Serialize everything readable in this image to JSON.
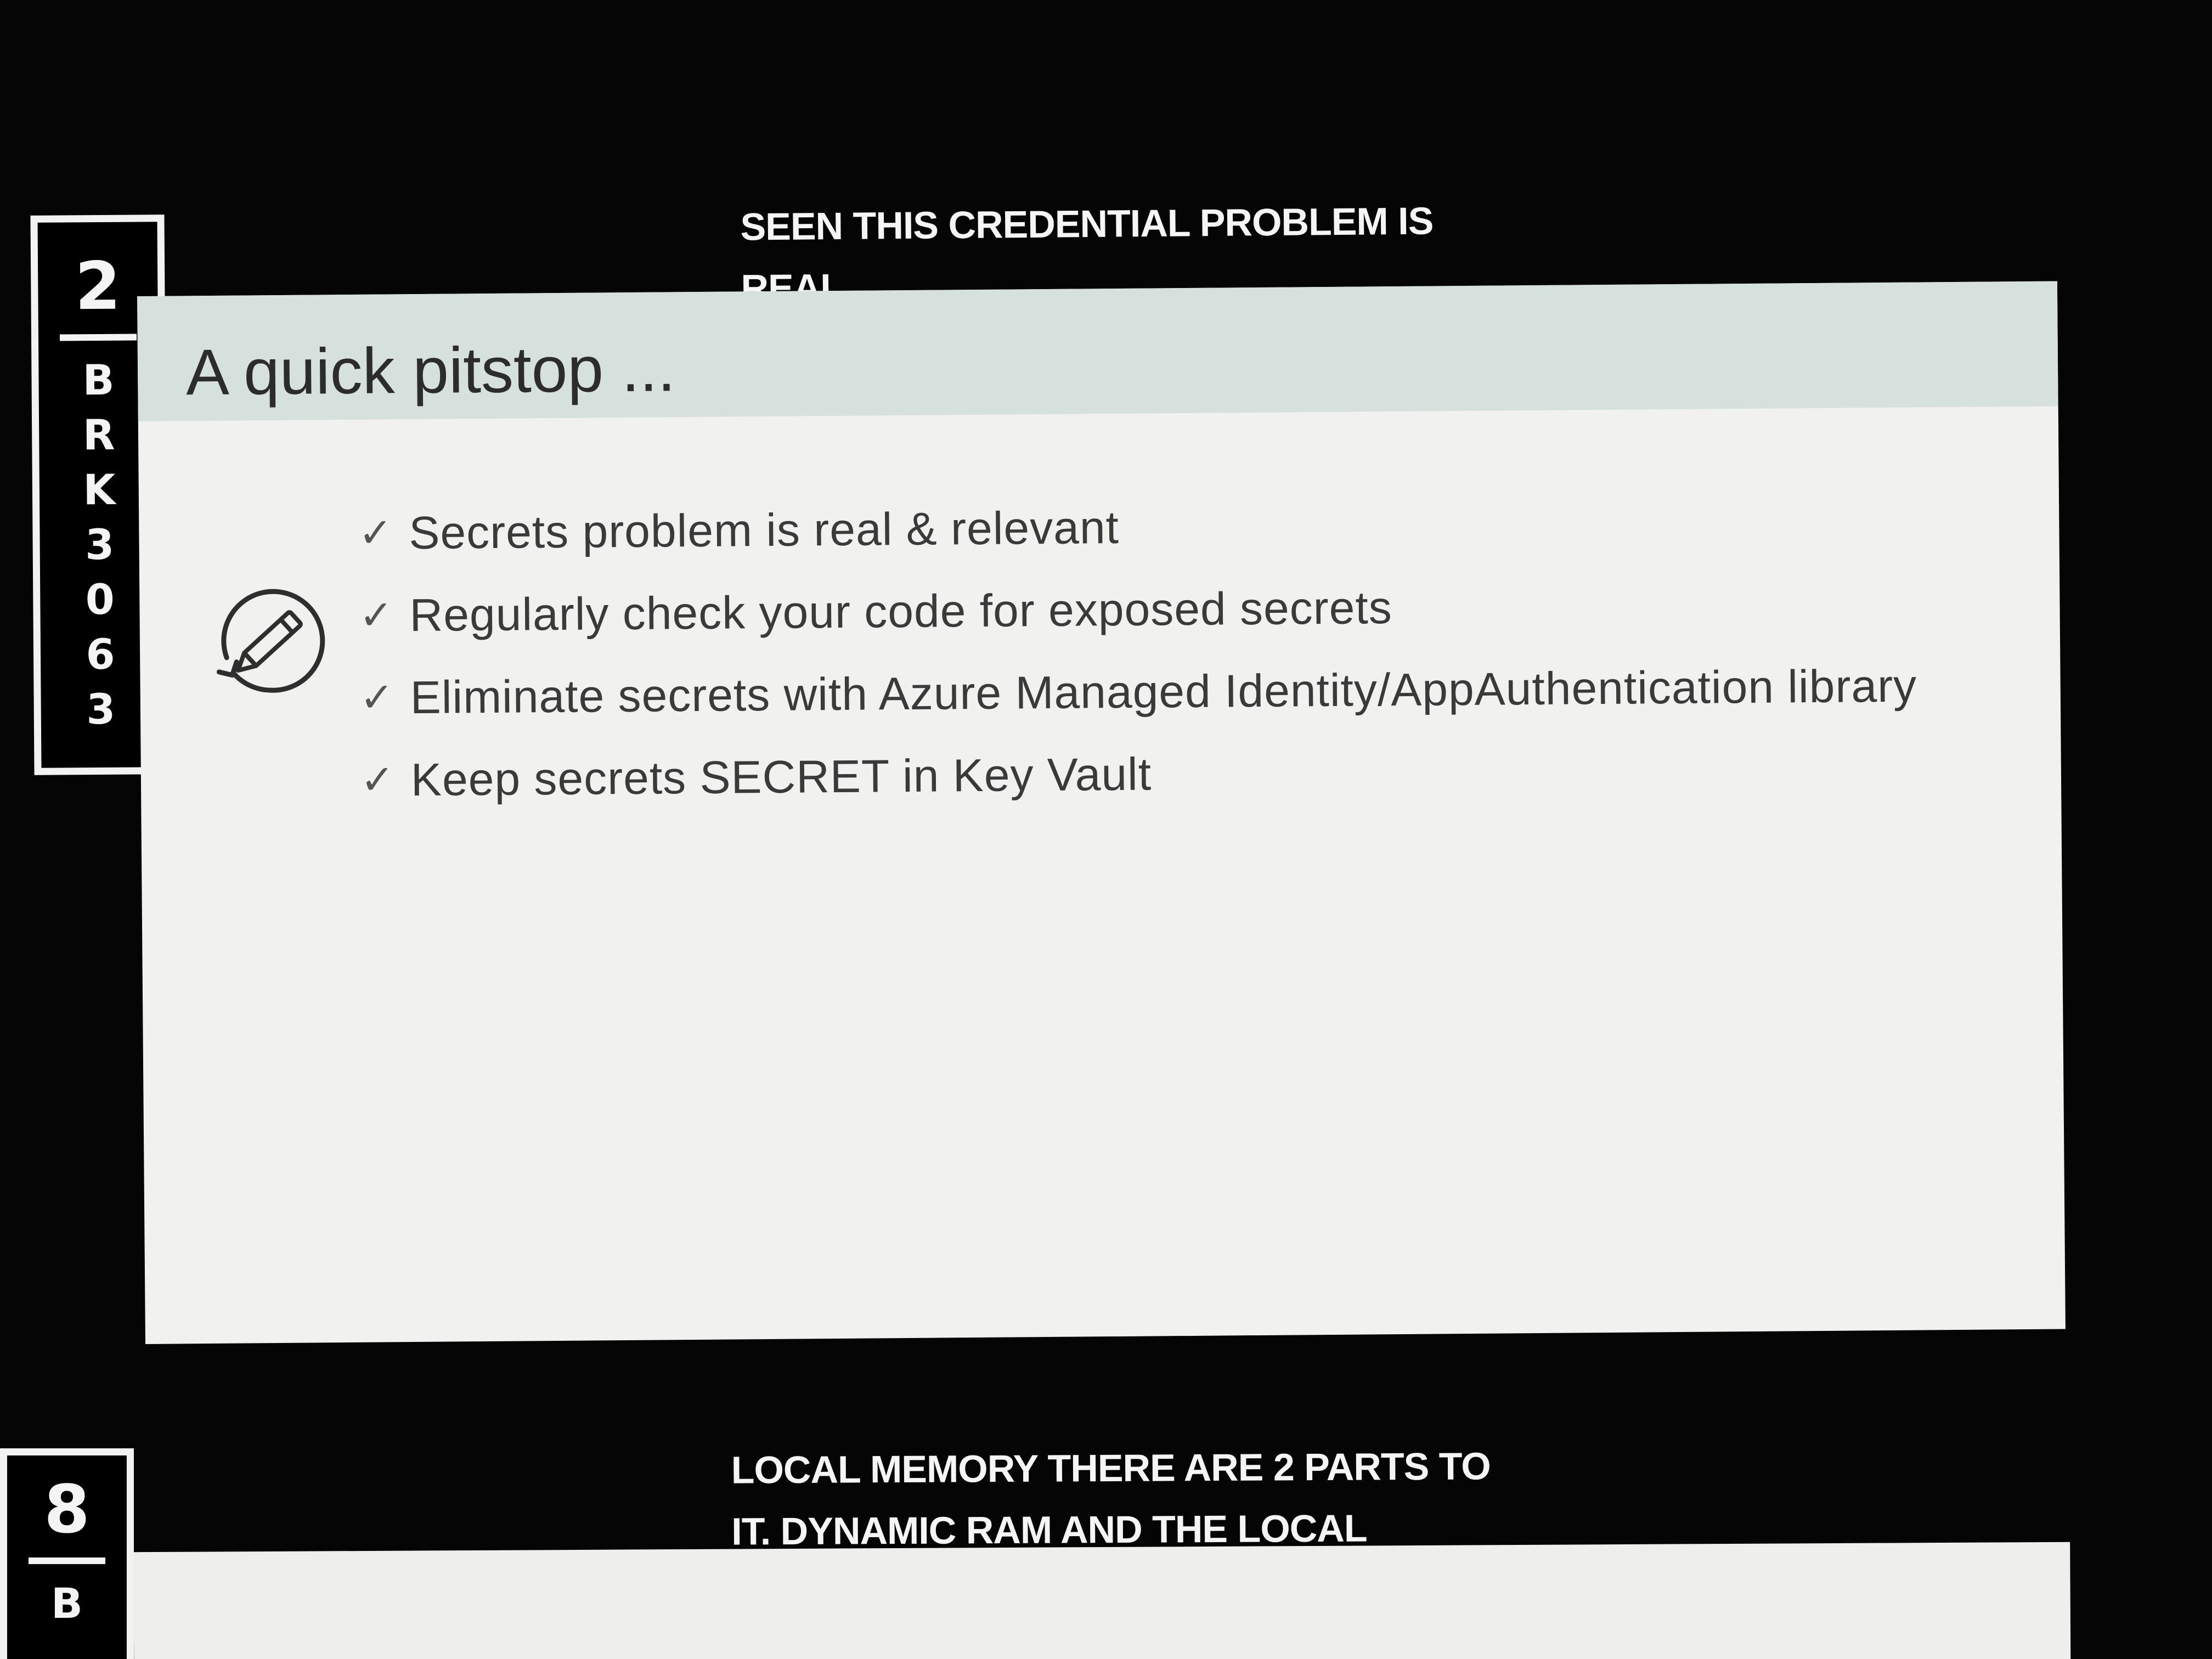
{
  "tile_top": {
    "number": "2",
    "code_chars": [
      "B",
      "R",
      "K",
      "3",
      "0",
      "6",
      "3"
    ]
  },
  "tile_bottom": {
    "number": "8",
    "code_chars": [
      "B"
    ]
  },
  "caption_top": {
    "lines": [
      "SEEN THIS  CREDENTIAL PROBLEM IS",
      "REAL."
    ]
  },
  "caption_bottom": {
    "lines": [
      "LOCAL MEMORY  THERE ARE 2 PARTS TO",
      "IT.  DYNAMIC RAM AND THE LOCAL"
    ]
  },
  "slide": {
    "title": "A quick pitstop ...",
    "icon": "pencil-refresh-icon",
    "check_glyph": "✓",
    "bullets": [
      "Secrets problem is real & relevant",
      "Regularly check your code for exposed secrets",
      "Eliminate secrets with Azure Managed Identity/AppAuthentication library",
      "Keep secrets SECRET in Key Vault"
    ]
  },
  "colors": {
    "background": "#050505",
    "slide_body": "#f1f2f0",
    "slide_header": "#d6e0dd",
    "caption_text": "#f5f5f5"
  }
}
